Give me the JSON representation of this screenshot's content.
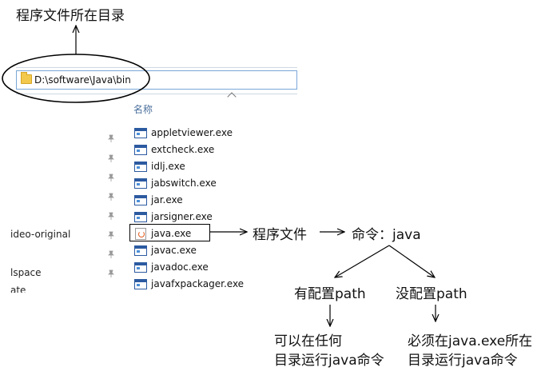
{
  "annotations": {
    "dir_label": "程序文件所在目录",
    "program_file": "程序文件",
    "command": "命令：java",
    "configured": "有配置path",
    "not_configured": "没配置path",
    "configured_result_line1": "可以在任何",
    "configured_result_line2": "目录运行java命令",
    "not_configured_result_line1": "必须在java.exe所在",
    "not_configured_result_line2": "目录运行java命令"
  },
  "explorer": {
    "address_path": "D:\\software\\Java\\bin",
    "column_header": "名称",
    "files": [
      {
        "name": "appletviewer.exe",
        "icon": "exe-window-icon"
      },
      {
        "name": "extcheck.exe",
        "icon": "exe-window-icon"
      },
      {
        "name": "idlj.exe",
        "icon": "exe-window-icon"
      },
      {
        "name": "jabswitch.exe",
        "icon": "exe-window-icon"
      },
      {
        "name": "jar.exe",
        "icon": "exe-window-icon"
      },
      {
        "name": "jarsigner.exe",
        "icon": "exe-window-icon"
      },
      {
        "name": "java.exe",
        "icon": "java-cup-icon"
      },
      {
        "name": "javac.exe",
        "icon": "exe-window-icon"
      },
      {
        "name": "javadoc.exe",
        "icon": "exe-window-icon"
      },
      {
        "name": "javafxpackager.exe",
        "icon": "exe-window-icon"
      }
    ],
    "sidebar_fragments": [
      "ideo-original",
      "lspace",
      "ate"
    ]
  }
}
